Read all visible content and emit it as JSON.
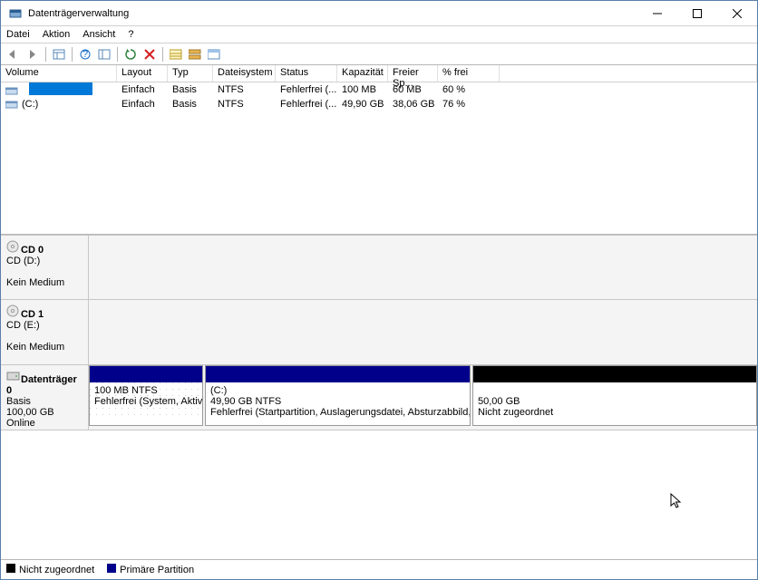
{
  "window": {
    "title": "Datenträgerverwaltung"
  },
  "menu": {
    "file": "Datei",
    "action": "Aktion",
    "view": "Ansicht",
    "help": "?"
  },
  "columns": {
    "volume": "Volume",
    "layout": "Layout",
    "type": "Typ",
    "filesystem": "Dateisystem",
    "status": "Status",
    "capacity": "Kapazität",
    "free": "Freier Sp...",
    "pfree": "% frei"
  },
  "rows": [
    {
      "name": "",
      "layout": "Einfach",
      "type": "Basis",
      "fs": "NTFS",
      "status": "Fehlerfrei (...",
      "cap": "100 MB",
      "free": "60 MB",
      "pfree": "60 %"
    },
    {
      "name": "(C:)",
      "layout": "Einfach",
      "type": "Basis",
      "fs": "NTFS",
      "status": "Fehlerfrei (...",
      "cap": "49,90 GB",
      "free": "38,06 GB",
      "pfree": "76 %"
    }
  ],
  "disks": [
    {
      "title": "CD 0",
      "sub1": "CD (D:)",
      "sub2": "",
      "sub3": "Kein Medium"
    },
    {
      "title": "CD 1",
      "sub1": "CD (E:)",
      "sub2": "",
      "sub3": "Kein Medium"
    },
    {
      "title": "Datenträger 0",
      "sub1": "Basis",
      "sub2": "100,00 GB",
      "sub3": "Online"
    }
  ],
  "partitions": [
    {
      "line1": "",
      "size": "100 MB NTFS",
      "status": "Fehlerfrei (System, Aktiv, Primäre Partition)"
    },
    {
      "line1": "(C:)",
      "size": "49,90 GB NTFS",
      "status": "Fehlerfrei (Startpartition, Auslagerungsdatei, Absturzabbild, Primäre Partition)"
    },
    {
      "line1": "",
      "size": "50,00 GB",
      "status": "Nicht zugeordnet"
    }
  ],
  "legend": {
    "unalloc": "Nicht zugeordnet",
    "primary": "Primäre Partition"
  }
}
